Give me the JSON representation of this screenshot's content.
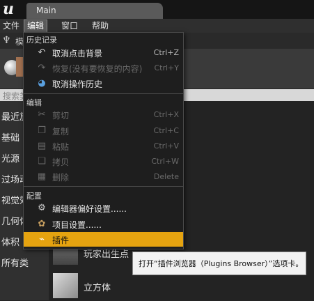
{
  "window": {
    "logo_text": "u",
    "tab_title": "Main"
  },
  "menubar": {
    "items": [
      {
        "label": "文件"
      },
      {
        "label": "编辑"
      },
      {
        "label": "窗口"
      },
      {
        "label": "帮助"
      }
    ],
    "active_index": 1
  },
  "modes": {
    "label": "模"
  },
  "search": {
    "placeholder": "搜索类"
  },
  "categories": [
    "最近放",
    "基础",
    "光源",
    "过场动",
    "视觉效",
    "几何体",
    "体积",
    "所有类"
  ],
  "list_items": [
    {
      "label": "玩家出生点",
      "icon": "player-start-icon"
    },
    {
      "label": "立方体",
      "icon": "cube-icon"
    }
  ],
  "edit_menu": {
    "sections": [
      {
        "header": "历史记录",
        "items": [
          {
            "label": "取消点击背景",
            "shortcut": "Ctrl+Z",
            "icon": "undo-icon",
            "disabled": false
          },
          {
            "label": "恢复(没有要恢复的内容)",
            "shortcut": "Ctrl+Y",
            "icon": "redo-icon",
            "disabled": true
          },
          {
            "label": "取消操作历史",
            "shortcut": "",
            "icon": "history-icon",
            "disabled": false
          }
        ]
      },
      {
        "header": "编辑",
        "items": [
          {
            "label": "剪切",
            "shortcut": "Ctrl+X",
            "icon": "scissors-icon",
            "disabled": true
          },
          {
            "label": "复制",
            "shortcut": "Ctrl+C",
            "icon": "copy-icon",
            "disabled": true
          },
          {
            "label": "粘贴",
            "shortcut": "Ctrl+V",
            "icon": "paste-icon",
            "disabled": true
          },
          {
            "label": "拷贝",
            "shortcut": "Ctrl+W",
            "icon": "duplicate-icon",
            "disabled": true
          },
          {
            "label": "删除",
            "shortcut": "Delete",
            "icon": "delete-icon",
            "disabled": true
          }
        ]
      },
      {
        "header": "配置",
        "items": [
          {
            "label": "编辑器偏好设置......",
            "shortcut": "",
            "icon": "editor-preferences-icon",
            "disabled": false
          },
          {
            "label": "项目设置......",
            "shortcut": "",
            "icon": "project-settings-icon",
            "disabled": false
          },
          {
            "label": "插件",
            "shortcut": "",
            "icon": "plugin-icon",
            "disabled": false,
            "highlighted": true
          }
        ]
      }
    ]
  },
  "tooltip": {
    "text": "打开“插件浏览器（Plugins Browser）”选项卡。"
  },
  "colors": {
    "highlight": "#e5a310",
    "menu_bg": "#1e1e1e",
    "app_bg": "#242424"
  }
}
